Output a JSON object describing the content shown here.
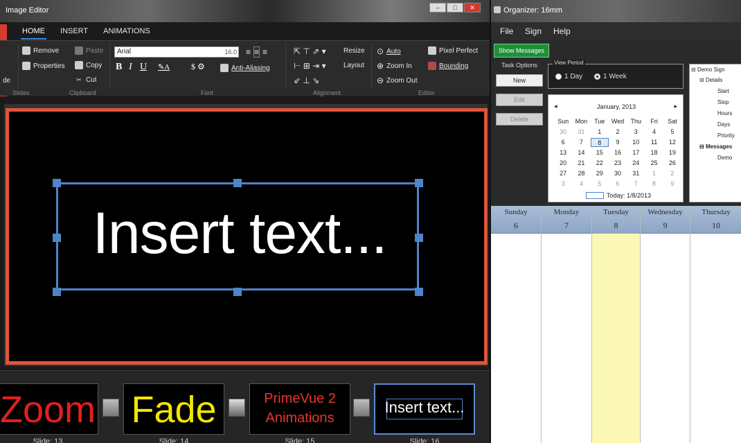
{
  "editor": {
    "title": "Image Editor",
    "tabs": [
      "HOME",
      "INSERT",
      "ANIMATIONS"
    ],
    "slides_group": {
      "label": "Slides",
      "partial_button": "de"
    },
    "clipboard": {
      "label": "Clipboard",
      "remove": "Remove",
      "properties": "Properties",
      "paste": "Paste",
      "copy": "Copy",
      "cut": "Cut"
    },
    "font": {
      "label": "Font",
      "family": "Arial",
      "size": "16.0",
      "bold": "B",
      "italic": "I",
      "underline": "U",
      "antialias": "Anti-Aliasing"
    },
    "alignment": {
      "label": "Alignment",
      "resize": "Resize",
      "layout": "Layout"
    },
    "editor_group": {
      "label": "Editor",
      "auto": "Auto",
      "zoom_in": "Zoom In",
      "zoom_out": "Zoom Out",
      "pixel_perfect": "Pixel Perfect",
      "bounding": "Bounding"
    },
    "canvas_text": "Insert text...",
    "slides": [
      {
        "text": "Zoom",
        "label": "Slide: 13",
        "color": "#e02020"
      },
      {
        "text": "Fade",
        "label": "Slide: 14",
        "color": "#f2e600"
      },
      {
        "text_line1": "PrimeVue 2",
        "text_line2": "Animations",
        "label": "Slide: 15",
        "color": "#e8352a"
      },
      {
        "text": "Insert text...",
        "label": "Slide: 16",
        "color": "#ffffff"
      }
    ]
  },
  "organizer": {
    "title": "Organizer: 16mm",
    "menu": [
      "File",
      "Sign",
      "Help"
    ],
    "show_messages": "Show Messages",
    "task_options": {
      "label": "Task Options",
      "new": "New",
      "edit": "Edit",
      "delete": "Delete"
    },
    "view_period": {
      "label": "View Period",
      "day": "1 Day",
      "week": "1 Week"
    },
    "calendar": {
      "month": "January, 2013",
      "prev": "◂",
      "next": "▸",
      "weekdays": [
        "Sun",
        "Mon",
        "Tue",
        "Wed",
        "Thu",
        "Fri",
        "Sat"
      ],
      "today": "Today: 1/8/2013"
    },
    "tree": {
      "root": "Demo Sign",
      "details": "Details",
      "children": [
        "Start",
        "Stop",
        "Hours",
        "Days",
        "Priority"
      ],
      "messages": "Messages",
      "message_children": [
        "Demo"
      ]
    },
    "week": {
      "days": [
        {
          "name": "Sunday",
          "num": "6"
        },
        {
          "name": "Monday",
          "num": "7"
        },
        {
          "name": "Tuesday",
          "num": "8"
        },
        {
          "name": "Wednesday",
          "num": "9"
        },
        {
          "name": "Thursday",
          "num": "10"
        }
      ]
    }
  }
}
